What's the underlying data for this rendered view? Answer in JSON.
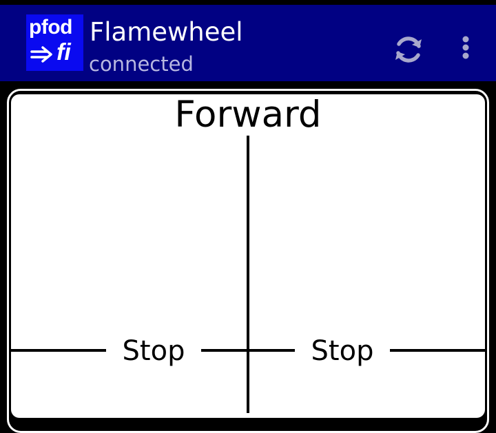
{
  "app_bar": {
    "logo": {
      "top_text": "pfod",
      "bottom_text": "fi",
      "icon": "arrow-right-icon"
    },
    "title": "Flamewheel",
    "subtitle": "connected",
    "actions": [
      {
        "icon": "refresh-icon"
      },
      {
        "icon": "overflow-menu-icon"
      }
    ],
    "colors": {
      "background": "#010183",
      "logo_background": "#0A0AF0",
      "title": "#ffffff",
      "subtitle": "#b7b7e0"
    }
  },
  "control_panel": {
    "forward_label": "Forward",
    "left_stop_label": "Stop",
    "right_stop_label": "Stop",
    "colors": {
      "background": "#ffffff",
      "lines": "#000000",
      "text": "#000000"
    }
  }
}
